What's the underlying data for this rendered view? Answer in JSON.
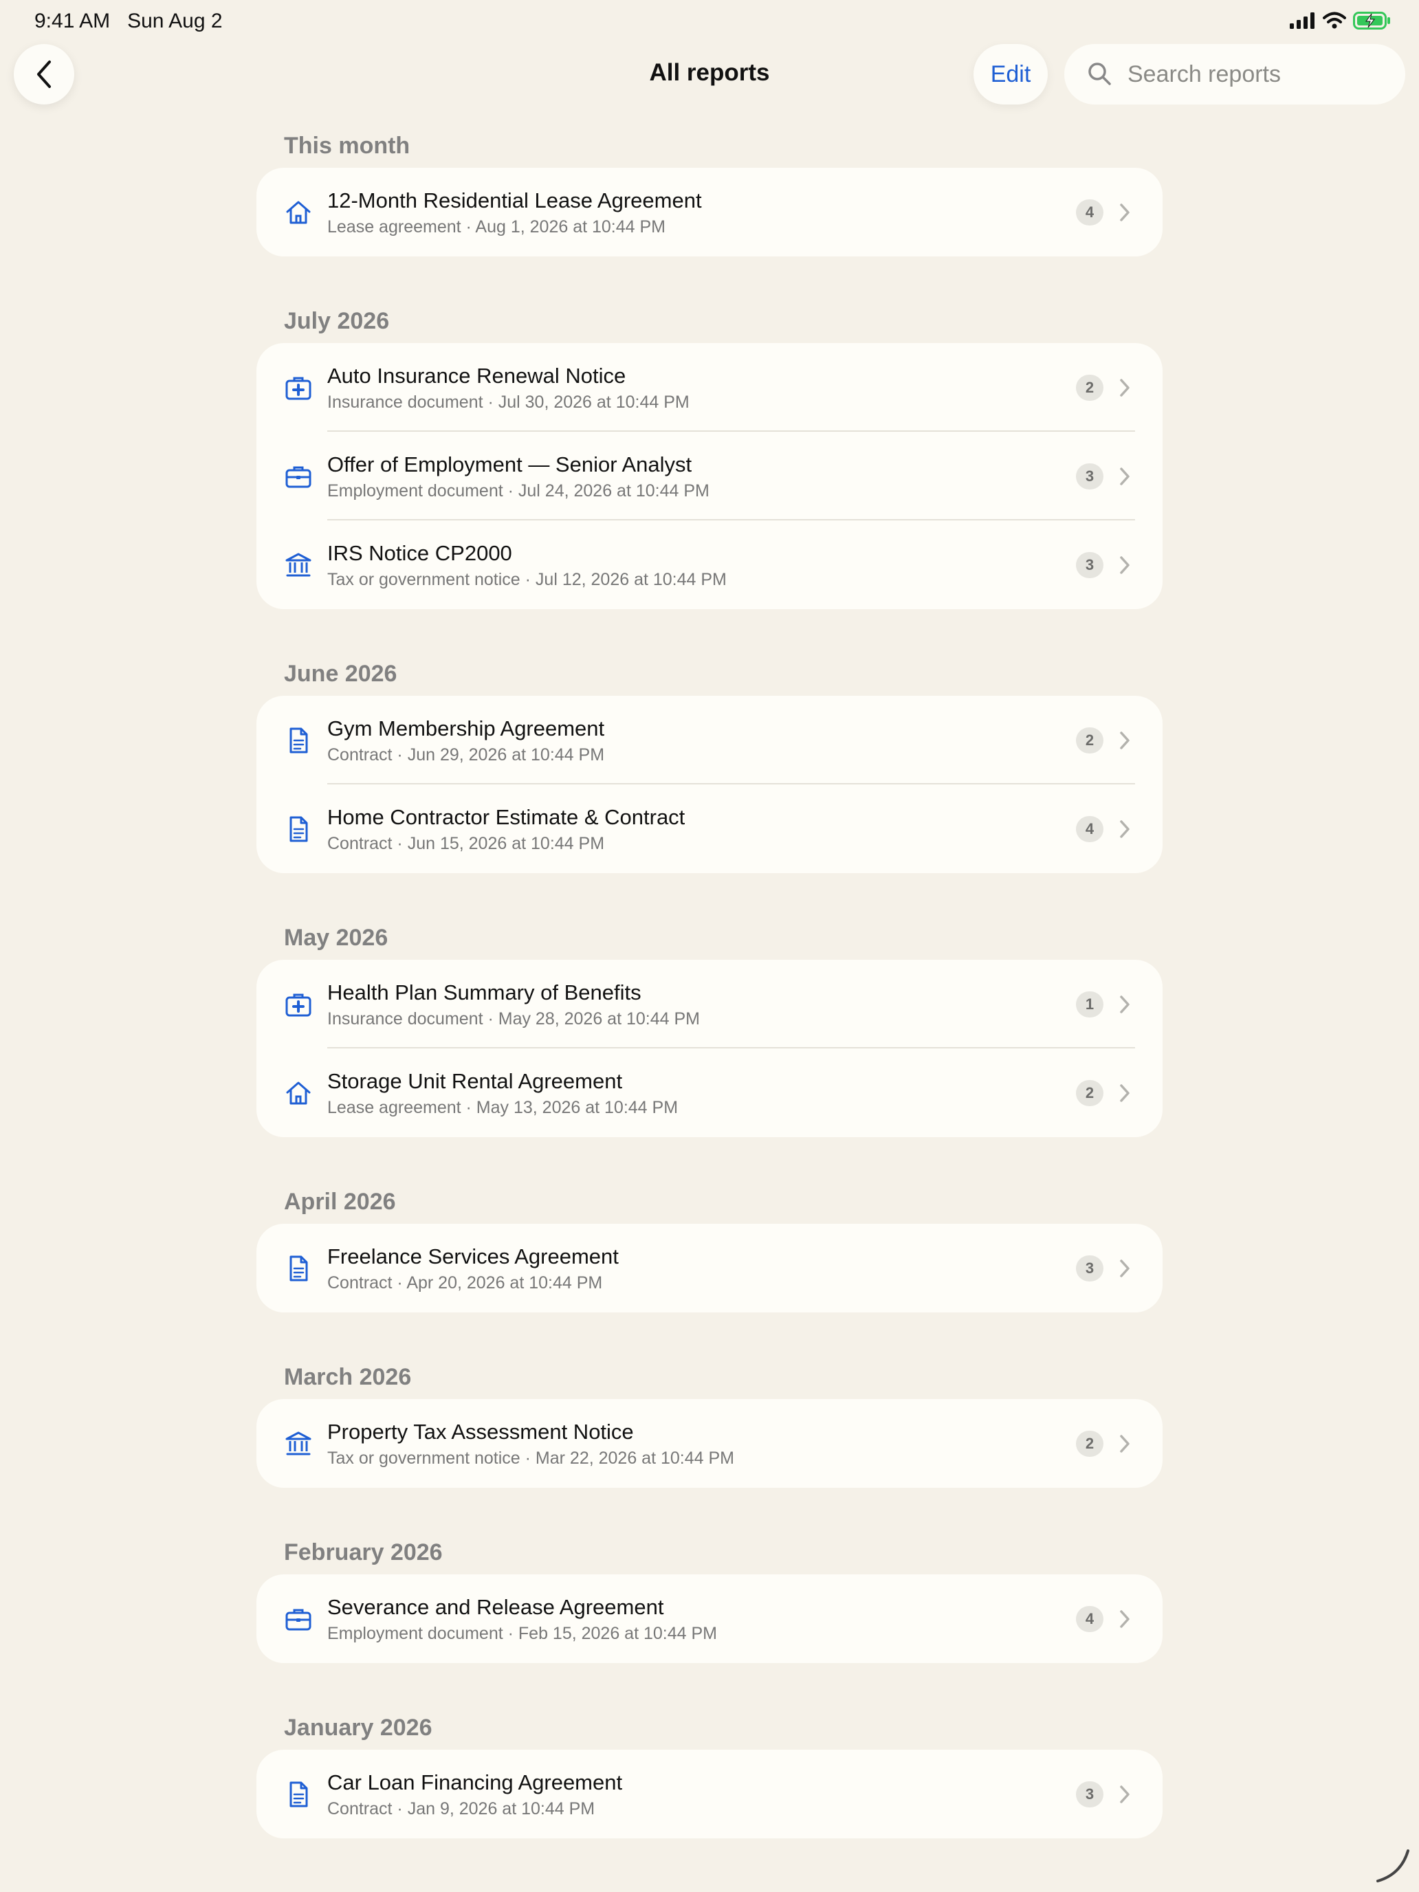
{
  "status_bar": {
    "time": "9:41 AM",
    "date": "Sun Aug 2"
  },
  "nav": {
    "title": "All reports",
    "edit_label": "Edit",
    "search_placeholder": "Search reports"
  },
  "colors": {
    "accent": "#1f5fd4",
    "background": "#f5f1e8",
    "card": "#fefdf8",
    "battery": "#34c759"
  },
  "sections": [
    {
      "header": "This month",
      "items": [
        {
          "icon": "house-icon",
          "title": "12-Month Residential Lease Agreement",
          "subtitle": "Lease agreement · Aug 1, 2026 at 10:44 PM",
          "count": "4"
        }
      ]
    },
    {
      "header": "July 2026",
      "items": [
        {
          "icon": "medical-case-icon",
          "title": "Auto Insurance Renewal Notice",
          "subtitle": "Insurance document · Jul 30, 2026 at 10:44 PM",
          "count": "2"
        },
        {
          "icon": "briefcase-icon",
          "title": "Offer of Employment — Senior Analyst",
          "subtitle": "Employment document · Jul 24, 2026 at 10:44 PM",
          "count": "3"
        },
        {
          "icon": "bank-building-icon",
          "title": "IRS Notice CP2000",
          "subtitle": "Tax or government notice · Jul 12, 2026 at 10:44 PM",
          "count": "3"
        }
      ]
    },
    {
      "header": "June 2026",
      "items": [
        {
          "icon": "document-icon",
          "title": "Gym Membership Agreement",
          "subtitle": "Contract · Jun 29, 2026 at 10:44 PM",
          "count": "2"
        },
        {
          "icon": "document-icon",
          "title": "Home Contractor Estimate & Contract",
          "subtitle": "Contract · Jun 15, 2026 at 10:44 PM",
          "count": "4"
        }
      ]
    },
    {
      "header": "May 2026",
      "items": [
        {
          "icon": "medical-case-icon",
          "title": "Health Plan Summary of Benefits",
          "subtitle": "Insurance document · May 28, 2026 at 10:44 PM",
          "count": "1"
        },
        {
          "icon": "house-icon",
          "title": "Storage Unit Rental Agreement",
          "subtitle": "Lease agreement · May 13, 2026 at 10:44 PM",
          "count": "2"
        }
      ]
    },
    {
      "header": "April 2026",
      "items": [
        {
          "icon": "document-icon",
          "title": "Freelance Services Agreement",
          "subtitle": "Contract · Apr 20, 2026 at 10:44 PM",
          "count": "3"
        }
      ]
    },
    {
      "header": "March 2026",
      "items": [
        {
          "icon": "bank-building-icon",
          "title": "Property Tax Assessment Notice",
          "subtitle": "Tax or government notice · Mar 22, 2026 at 10:44 PM",
          "count": "2"
        }
      ]
    },
    {
      "header": "February 2026",
      "items": [
        {
          "icon": "briefcase-icon",
          "title": "Severance and Release Agreement",
          "subtitle": "Employment document · Feb 15, 2026 at 10:44 PM",
          "count": "4"
        }
      ]
    },
    {
      "header": "January 2026",
      "items": [
        {
          "icon": "document-icon",
          "title": "Car Loan Financing Agreement",
          "subtitle": "Contract · Jan 9, 2026 at 10:44 PM",
          "count": "3"
        }
      ]
    }
  ]
}
